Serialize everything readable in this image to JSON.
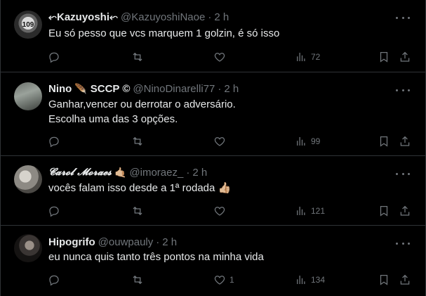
{
  "tweets": [
    {
      "name": "⬿Kazuyoshi⬿",
      "handle": "@KazuyoshiNaoe",
      "time": "2 h",
      "text": "Eu só pesso que vcs marquem 1 golzin, é só isso",
      "replies": "",
      "retweets": "",
      "likes": "",
      "views": "72",
      "avatar": "109"
    },
    {
      "name": "Nino",
      "name_suffix": "SCCP ©",
      "handle": "@NinoDinarelli77",
      "time": "2 h",
      "text": "Ganhar,vencer ou derrotar o adversário.\nEscolha uma das 3 opções.",
      "replies": "",
      "retweets": "",
      "likes": "",
      "views": "99",
      "emoji": "🪶"
    },
    {
      "name": "𝓒𝓪𝓻𝓸𝓵 𝓜𝓸𝓻𝓪𝓮𝓼",
      "handle": "@imoraez_",
      "time": "2 h",
      "text": "vocês falam isso desde a 1ª rodada 👍🏼",
      "replies": "",
      "retweets": "",
      "likes": "",
      "views": "121",
      "emoji": "🤙🏼"
    },
    {
      "name": "Hipogrifo",
      "handle": "@ouwpauly",
      "time": "2 h",
      "text": "eu nunca quis tanto três pontos na minha vida",
      "replies": "",
      "retweets": "",
      "likes": "1",
      "views": "134"
    }
  ],
  "dot": "·",
  "colors": {
    "background": "#000000",
    "text": "#e7e9ea",
    "muted": "#71767b",
    "divider": "#2f3336"
  },
  "icons": [
    "reply-icon",
    "retweet-icon",
    "like-icon",
    "views-icon",
    "bookmark-icon",
    "share-icon",
    "more-icon"
  ]
}
